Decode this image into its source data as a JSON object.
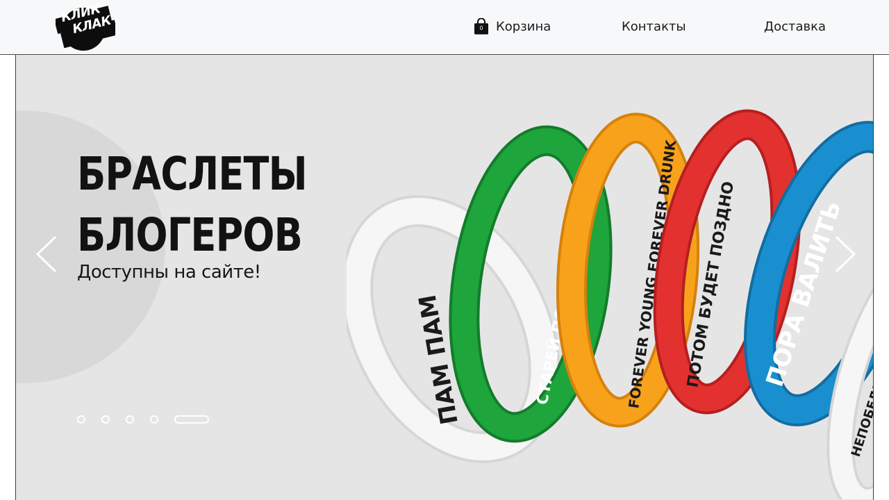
{
  "header": {
    "logo_text_line1": "КЛИК",
    "logo_text_line2": "КЛАК",
    "nav": {
      "cart_label": "Корзина",
      "cart_count": "0",
      "contacts_label": "Контакты",
      "delivery_label": "Доставка"
    }
  },
  "hero": {
    "title_line1": "БРАСЛЕТЫ",
    "title_line2": "БЛОГЕРОВ",
    "subtitle": "Доступны на сайте!",
    "slides_total": 5,
    "active_slide": 5,
    "bracelets": [
      {
        "text": "ПАМ ПАМ",
        "color": "#f4f4f4",
        "text_color": "#1a1a1a"
      },
      {
        "text": "СТАРЕЙ ПОКА МОЛОДОЙ",
        "color": "#1ea53c",
        "text_color": "#ffffff"
      },
      {
        "text": "FOREVER YOUNG FOREVER DRUNK",
        "color": "#f8a21c",
        "text_color": "#1a1a1a"
      },
      {
        "text": "ПОТОМ БУДЕТ ПОЗДНО",
        "color": "#e3312f",
        "text_color": "#1a1a1a"
      },
      {
        "text": "ПОРА ВАЛИТЬ",
        "color": "#1a8fd0",
        "text_color": "#ffffff"
      },
      {
        "text": "НЕПОБЕДИМАЯ СИ",
        "color": "#f4f4f4",
        "text_color": "#1a1a1a"
      }
    ]
  },
  "colors": {
    "header_bg": "#f7f8f9",
    "hero_bg": "#e6e5e6",
    "text_dark": "#121212"
  },
  "icons": {
    "cart": "shopping-bag-icon",
    "prev": "chevron-left-icon",
    "next": "chevron-right-icon"
  }
}
